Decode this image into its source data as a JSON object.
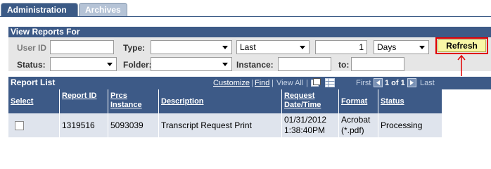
{
  "tabs": [
    {
      "label": "Administration"
    },
    {
      "label": "Archives"
    }
  ],
  "view_reports": {
    "title": "View Reports For",
    "user_id": {
      "label": "User ID",
      "value": ""
    },
    "type": {
      "label": "Type:",
      "value": ""
    },
    "last": {
      "value": "Last"
    },
    "count": {
      "value": "1"
    },
    "units": {
      "value": "Days"
    },
    "refresh": {
      "label": "Refresh"
    },
    "status": {
      "label": "Status:",
      "value": ""
    },
    "folder": {
      "label": "Folder:",
      "value": ""
    },
    "instance": {
      "label": "Instance:",
      "value": ""
    },
    "to": {
      "label": "to:",
      "value": ""
    }
  },
  "report_list": {
    "title": "Report List",
    "nav": {
      "customize": "Customize",
      "sep1": "|",
      "find": "Find",
      "sep2": "|",
      "view_all": "View All",
      "sep3": "|",
      "first": "First",
      "range": "1 of 1",
      "last": "Last"
    },
    "columns": [
      {
        "label": "Select"
      },
      {
        "label": "Report ID"
      },
      {
        "label": "Prcs Instance"
      },
      {
        "label": "Description"
      },
      {
        "label": "Request Date/Time"
      },
      {
        "label": "Format"
      },
      {
        "label": "Status"
      }
    ],
    "rows": [
      {
        "report_id": "1319516",
        "prcs_instance": "5093039",
        "description": "Transcript Request Print",
        "request_date": "01/31/2012",
        "request_time": "1:38:40PM",
        "format": "Acrobat (*.pdf)",
        "status": "Processing"
      }
    ]
  },
  "colors": {
    "header_bg": "#3d5a87",
    "refresh_bg": "#f9f7a6",
    "highlight": "#e00000",
    "row_bg": "#dfe4ed"
  }
}
